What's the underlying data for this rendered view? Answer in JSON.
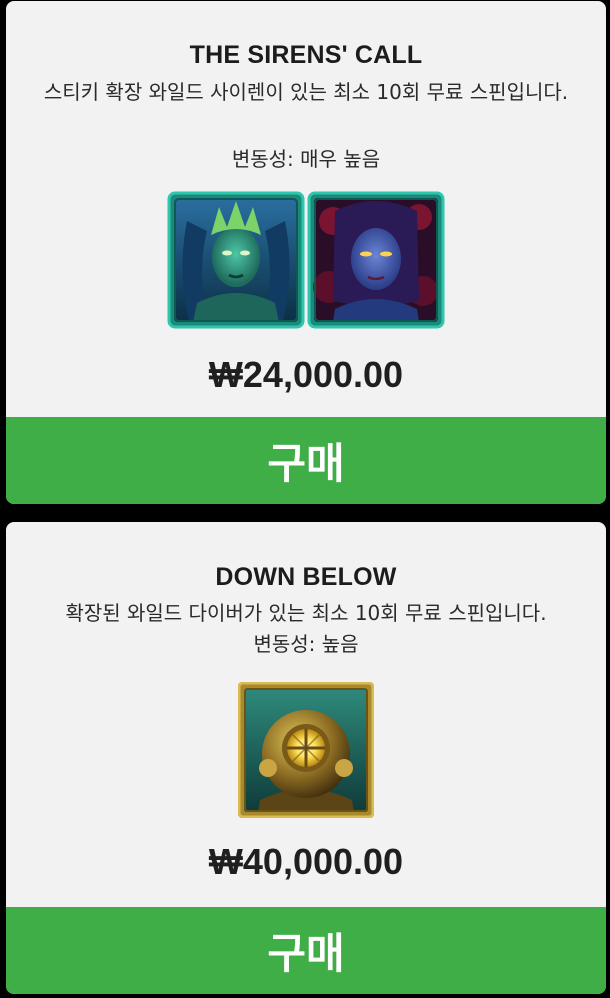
{
  "offers": [
    {
      "title": "THE SIRENS' CALL",
      "description": "스티키 확장 와일드 사이렌이 있는 최소 10회 무료 스핀입니다.",
      "volatility": "변동성: 매우 높음",
      "symbols": [
        "green-siren-symbol",
        "blue-siren-symbol"
      ],
      "price": "₩24,000.00",
      "buy_label": "구매"
    },
    {
      "title": "DOWN BELOW",
      "description": "확장된 와일드 다이버가 있는 최소 10회 무료 스핀입니다.",
      "volatility": "변동성: 높음",
      "symbols": [
        "diver-helmet-symbol"
      ],
      "price": "₩40,000.00",
      "buy_label": "구매"
    }
  ],
  "colors": {
    "card_background": "#f2f2f3",
    "buy_button": "#3fae47",
    "page_background": "#000000"
  }
}
